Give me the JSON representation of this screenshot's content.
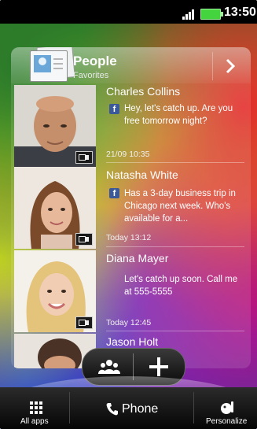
{
  "status_bar": {
    "time": "13:50"
  },
  "widget": {
    "title": "People",
    "subtitle": "Favorites",
    "contacts": [
      {
        "name": "Charles Collins",
        "message": "Hey, let's catch up. Are you free tomorrow night?",
        "source": "facebook",
        "timestamp": "21/09 10:35"
      },
      {
        "name": "Natasha White",
        "message": "Has a 3-day business trip in Chicago next week. Who's available for a...",
        "source": "facebook",
        "timestamp": "Today 13:12"
      },
      {
        "name": "Diana Mayer",
        "message": "Let's catch up soon. Call me at 555-5555",
        "source": "sms",
        "timestamp": "Today 12:45"
      },
      {
        "name": "Jason Holt",
        "message": "",
        "source": "",
        "timestamp": ""
      }
    ]
  },
  "dock": {
    "all_apps_label": "All apps",
    "phone_label": "Phone",
    "personalize_label": "Personalize"
  }
}
